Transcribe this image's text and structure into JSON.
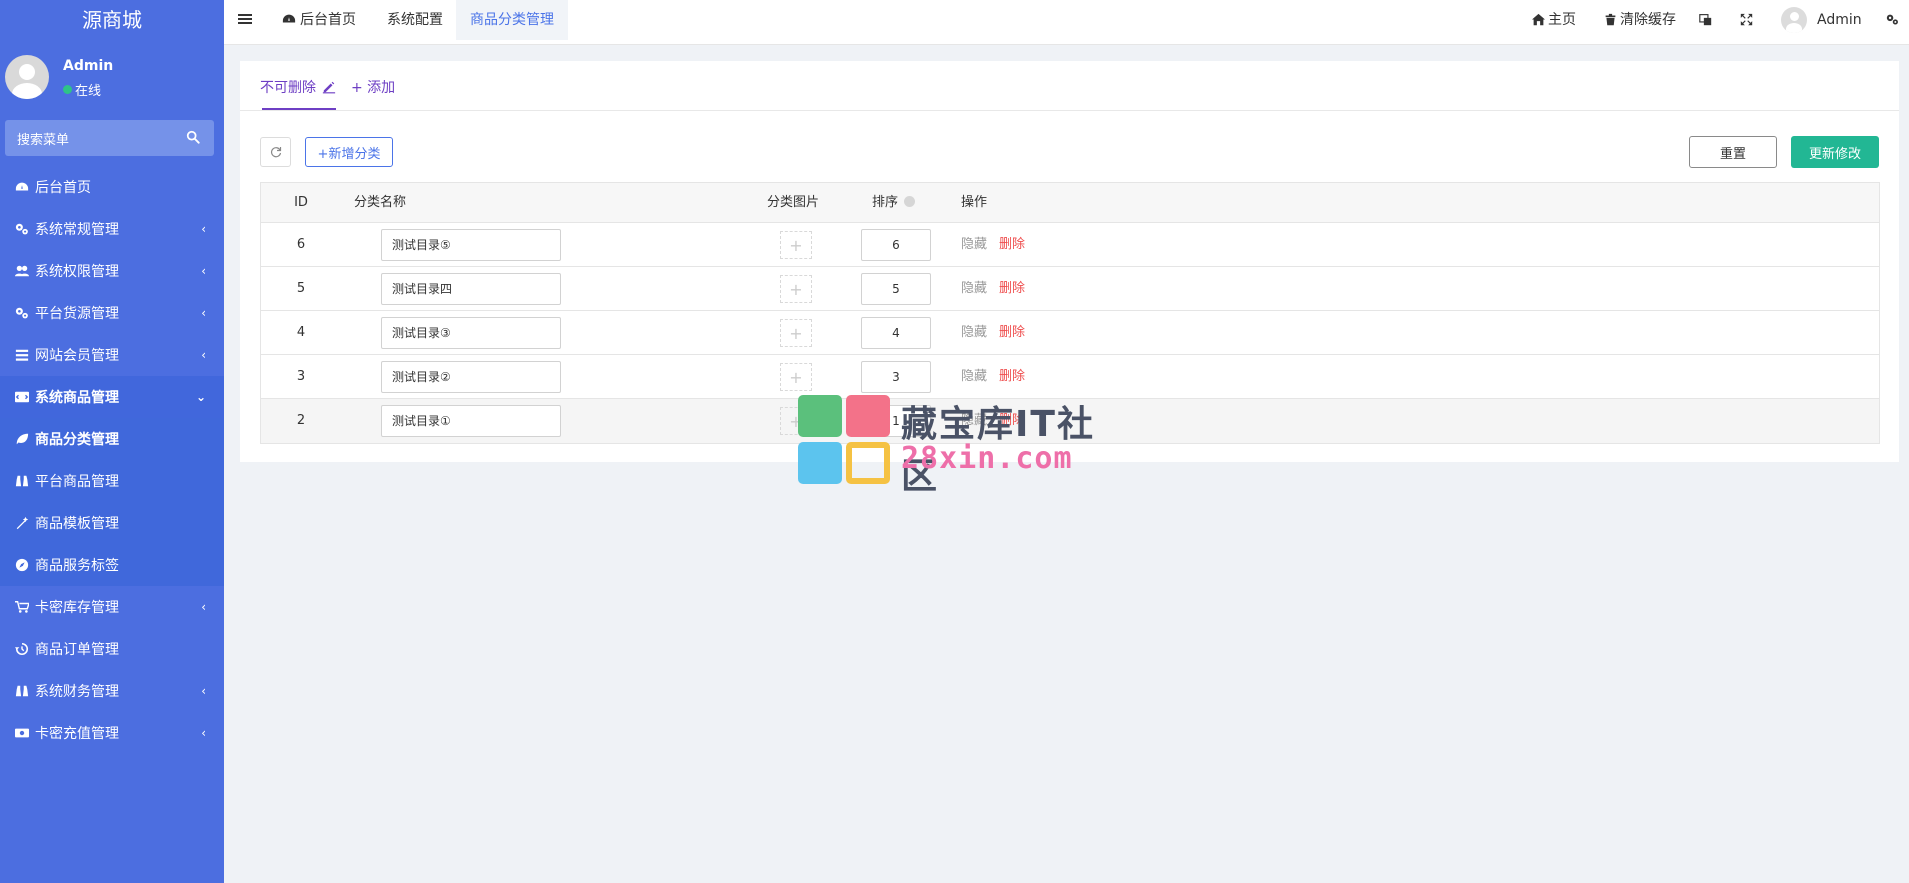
{
  "sidebar": {
    "brand": "源商城",
    "user_name": "Admin",
    "user_status": "在线",
    "search_placeholder": "搜索菜单",
    "items": [
      {
        "label": "后台首页",
        "icon": "dashboard-icon"
      },
      {
        "label": "系统常规管理",
        "icon": "cogs-icon",
        "arrow": "‹"
      },
      {
        "label": "系统权限管理",
        "icon": "users-icon",
        "arrow": "‹"
      },
      {
        "label": "平台货源管理",
        "icon": "cogs-icon",
        "arrow": "‹"
      },
      {
        "label": "网站会员管理",
        "icon": "list-icon",
        "arrow": "‹"
      },
      {
        "label": "系统商品管理",
        "icon": "code-icon",
        "arrow": "⌄"
      },
      {
        "label": "商品分类管理",
        "icon": "leaf-icon"
      },
      {
        "label": "平台商品管理",
        "icon": "binoculars-icon"
      },
      {
        "label": "商品模板管理",
        "icon": "magic-icon"
      },
      {
        "label": "商品服务标签",
        "icon": "compass-icon"
      },
      {
        "label": "卡密库存管理",
        "icon": "cart-icon",
        "arrow": "‹"
      },
      {
        "label": "商品订单管理",
        "icon": "history-icon"
      },
      {
        "label": "系统财务管理",
        "icon": "binoculars-icon",
        "arrow": "‹"
      },
      {
        "label": "卡密充值管理",
        "icon": "money-icon",
        "arrow": "‹"
      }
    ]
  },
  "topbar": {
    "tabs": [
      "后台首页",
      "系统配置",
      "商品分类管理"
    ],
    "home": "主页",
    "clear_cache": "清除缓存",
    "admin": "Admin"
  },
  "panel": {
    "tab_current": "不可删除",
    "tab_add": "+ 添加",
    "add_category": "+新增分类",
    "reset": "重置",
    "update": "更新修改"
  },
  "table": {
    "headers": {
      "id": "ID",
      "name": "分类名称",
      "image": "分类图片",
      "sort": "排序",
      "action": "操作"
    },
    "rows": [
      {
        "id": "6",
        "name": "测试目录⑤",
        "sort": "6"
      },
      {
        "id": "5",
        "name": "测试目录四",
        "sort": "5"
      },
      {
        "id": "4",
        "name": "测试目录③",
        "sort": "4"
      },
      {
        "id": "3",
        "name": "测试目录②",
        "sort": "3"
      },
      {
        "id": "2",
        "name": "测试目录①",
        "sort": "1"
      }
    ],
    "hide_label": "隐藏",
    "delete_label": "删除",
    "image_placeholder": "+"
  },
  "watermark": {
    "line1": "藏宝库IT社区",
    "line2": "28xin.com",
    "colors": [
      "#5bc07c",
      "#f37289",
      "#5cc4ee",
      "#f5c243"
    ]
  }
}
